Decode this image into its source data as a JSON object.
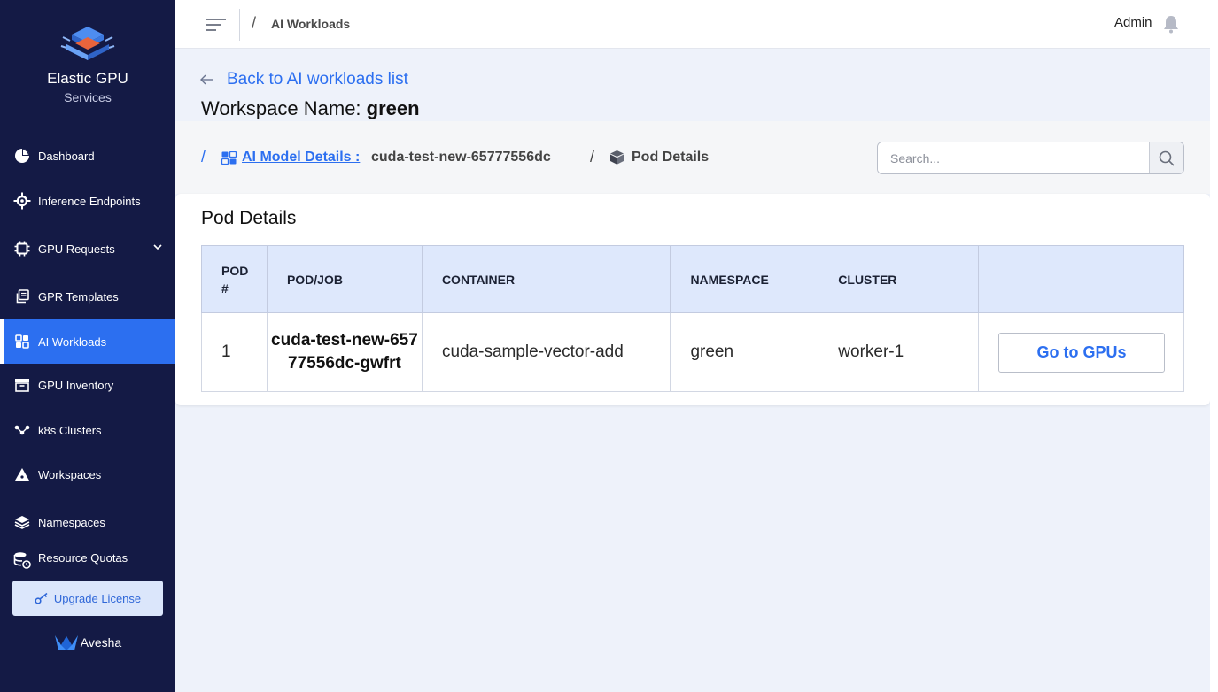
{
  "brand": {
    "title": "Elastic GPU",
    "subtitle": "Services"
  },
  "sidebar": {
    "items": [
      {
        "label": "Dashboard",
        "icon": "pie-chart-icon"
      },
      {
        "label": "Inference Endpoints",
        "icon": "gear-network-icon"
      },
      {
        "label": "GPU Requests",
        "icon": "chip-icon"
      },
      {
        "label": "GPR Templates",
        "icon": "copy-icon"
      },
      {
        "label": "AI Workloads",
        "icon": "grid-icon",
        "active": true
      },
      {
        "label": "GPU Inventory",
        "icon": "inventory-box-icon"
      },
      {
        "label": "k8s Clusters",
        "icon": "nodes-icon"
      },
      {
        "label": "Workspaces",
        "icon": "warning-tent-icon"
      },
      {
        "label": "Namespaces",
        "icon": "layers-icon"
      },
      {
        "label": "Resource Quotas",
        "icon": "database-clock-icon"
      }
    ],
    "upgrade_label": "Upgrade License",
    "footer_brand": "Avesha"
  },
  "topbar": {
    "breadcrumb_slash": "/",
    "breadcrumb": "AI Workloads",
    "user": "Admin"
  },
  "header": {
    "back_label": "Back to AI workloads list",
    "workspace_prefix": "Workspace Name:",
    "workspace_name": "green"
  },
  "crumbs": {
    "slash": "/",
    "model_link": "AI Model Details :",
    "model_name": "cuda-test-new-65777556dc",
    "current": "Pod Details"
  },
  "search": {
    "placeholder": "Search..."
  },
  "pod_details": {
    "title": "Pod Details",
    "columns": [
      "POD #",
      "POD/JOB",
      "CONTAINER",
      "NAMESPACE",
      "CLUSTER",
      ""
    ],
    "rows": [
      {
        "pod": "1",
        "job": "cuda-test-new-65777556dc-gwfrt",
        "container": "cuda-sample-vector-add",
        "namespace": "green",
        "cluster": "worker-1",
        "action": "Go to GPUs"
      }
    ]
  },
  "colors": {
    "sidebar_bg": "#141a45",
    "accent": "#2c6ff0",
    "table_header_bg": "#dee8fc",
    "page_bg": "#eef2fa"
  }
}
